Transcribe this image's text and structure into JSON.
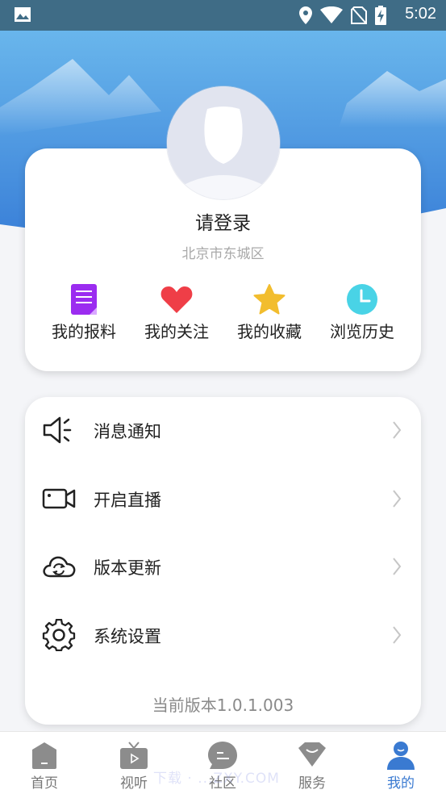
{
  "status_bar": {
    "time": "5:02",
    "icons": [
      "image-icon",
      "location-icon",
      "wifi-icon",
      "no-sim-icon",
      "battery-charging-icon"
    ]
  },
  "profile": {
    "login_text": "请登录",
    "location": "北京市东城区",
    "quick_actions": [
      {
        "label": "我的报料",
        "icon": "report-document-icon",
        "color": "#9b2cf0"
      },
      {
        "label": "我的关注",
        "icon": "heart-icon",
        "color": "#ef3e47"
      },
      {
        "label": "我的收藏",
        "icon": "star-icon",
        "color": "#f2bd2e"
      },
      {
        "label": "浏览历史",
        "icon": "clock-icon",
        "color": "#49d3e6"
      }
    ]
  },
  "menu": {
    "items": [
      {
        "label": "消息通知",
        "icon": "speaker-icon"
      },
      {
        "label": "开启直播",
        "icon": "video-camera-icon"
      },
      {
        "label": "版本更新",
        "icon": "cloud-refresh-icon"
      },
      {
        "label": "系统设置",
        "icon": "gear-icon"
      }
    ],
    "version_text": "当前版本1.0.1.003"
  },
  "tabbar": {
    "tabs": [
      {
        "label": "首页",
        "icon": "home-icon",
        "active": false
      },
      {
        "label": "视听",
        "icon": "tv-icon",
        "active": false
      },
      {
        "label": "社区",
        "icon": "chat-bubble-icon",
        "active": false
      },
      {
        "label": "服务",
        "icon": "diamond-icon",
        "active": false
      },
      {
        "label": "我的",
        "icon": "person-icon",
        "active": true
      }
    ],
    "active_color": "#3a7ad1",
    "inactive_color": "#8c8c8c"
  },
  "watermark": "下载 · ...ZXY.COM",
  "colors": {
    "header_blue": "#3e86d8",
    "status_bar": "#3f6c86"
  }
}
